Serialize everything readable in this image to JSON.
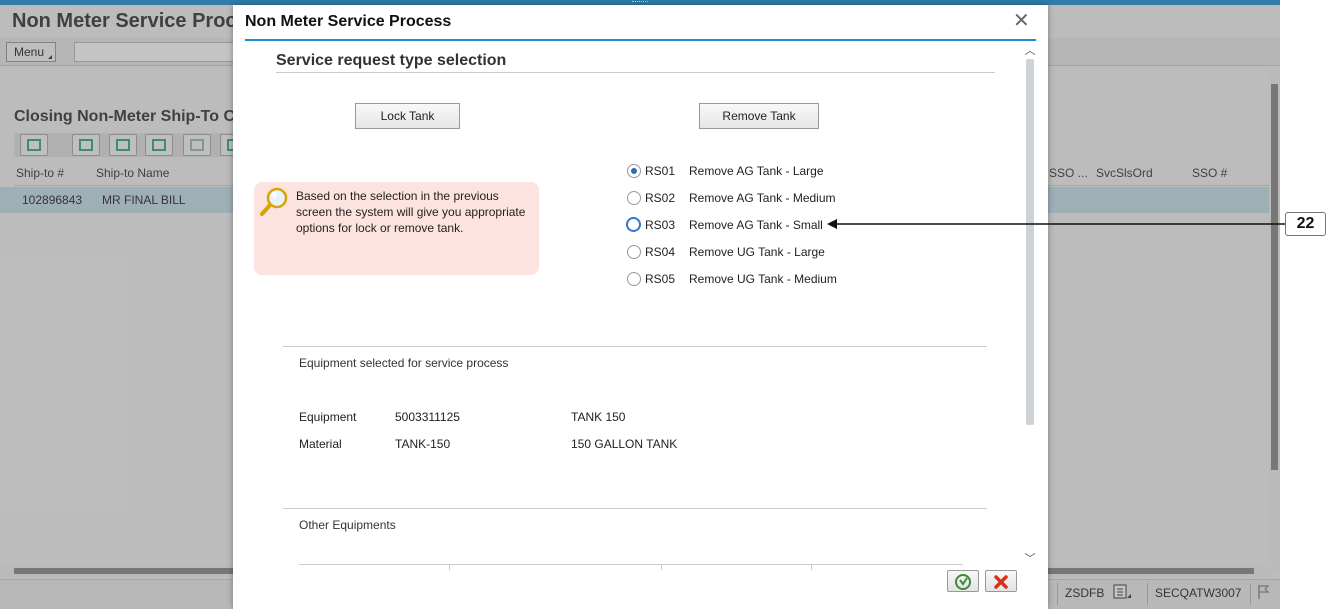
{
  "background": {
    "title": "Non Meter Service Proc",
    "menu_label": "Menu",
    "section_title": "Closing Non-Meter Ship-To C",
    "columns": {
      "ship_to": "Ship-to #",
      "ship_to_name": "Ship-to Name",
      "sso_dots": "SSO ...",
      "svc_sls_ord": "SvcSlsOrd",
      "sso_num": "SSO #"
    },
    "row": {
      "ship_to": "102896843",
      "ship_to_name": "MR FINAL BILL"
    },
    "status": {
      "program": "ZSDFB",
      "system": "SECQATW3007"
    }
  },
  "dialog": {
    "title": "Non Meter Service Process",
    "section_title": "Service request type selection",
    "lock_button": "Lock Tank",
    "remove_button": "Remove Tank",
    "callout_text": "Based on the selection in the previous screen the system will give  you appropriate options for lock or remove tank.",
    "options": [
      {
        "code": "RS01",
        "label": "Remove AG Tank - Large",
        "selected": true
      },
      {
        "code": "RS02",
        "label": "Remove AG Tank - Medium",
        "selected": false
      },
      {
        "code": "RS03",
        "label": "Remove AG Tank - Small",
        "selected": false,
        "focused": true
      },
      {
        "code": "RS04",
        "label": "Remove UG Tank - Large",
        "selected": false
      },
      {
        "code": "RS05",
        "label": "Remove UG Tank - Medium",
        "selected": false
      }
    ],
    "equipment_heading": "Equipment selected for service process",
    "equipment": {
      "label": "Equipment",
      "id": "5003311125",
      "desc": "TANK 150"
    },
    "material": {
      "label": "Material",
      "id": "TANK-150",
      "desc": "150 GALLON TANK"
    },
    "other_heading": "Other Equipments"
  },
  "annotation": {
    "step": "22"
  },
  "colors": {
    "accent": "#1a8fd6",
    "callout_bg": "#fde3e0",
    "cancel": "#d9301c",
    "confirm": "#3c8a3c"
  }
}
